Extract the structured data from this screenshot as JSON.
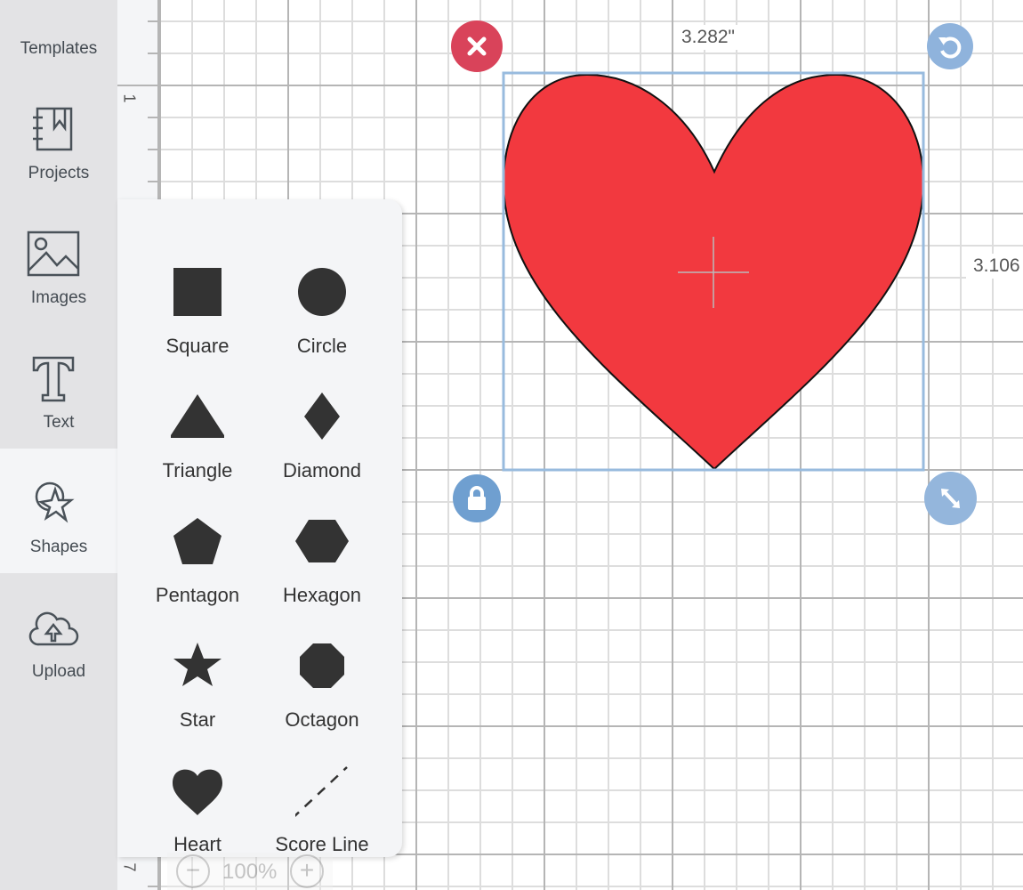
{
  "sidebar": {
    "items": [
      {
        "label": "Templates",
        "icon": "shirt-icon"
      },
      {
        "label": "Projects",
        "icon": "notebook-icon"
      },
      {
        "label": "Images",
        "icon": "image-icon"
      },
      {
        "label": "Text",
        "icon": "text-icon"
      },
      {
        "label": "Shapes",
        "icon": "shapes-icon",
        "active": true
      },
      {
        "label": "Upload",
        "icon": "cloud-upload-icon"
      }
    ]
  },
  "ruler": {
    "labels": [
      "1",
      "7"
    ]
  },
  "shapes_panel": {
    "items": [
      {
        "label": "Square"
      },
      {
        "label": "Circle"
      },
      {
        "label": "Triangle"
      },
      {
        "label": "Diamond"
      },
      {
        "label": "Pentagon"
      },
      {
        "label": "Hexagon"
      },
      {
        "label": "Star"
      },
      {
        "label": "Octagon"
      },
      {
        "label": "Heart"
      },
      {
        "label": "Score Line"
      }
    ]
  },
  "selection": {
    "width_label": "3.282\"",
    "height_label": "3.106",
    "fill_color": "#f2393f",
    "delete_color": "#d9435a",
    "handle_color": "#8fb3dc"
  },
  "zoom": {
    "value": "100%",
    "minus": "−",
    "plus": "+"
  }
}
